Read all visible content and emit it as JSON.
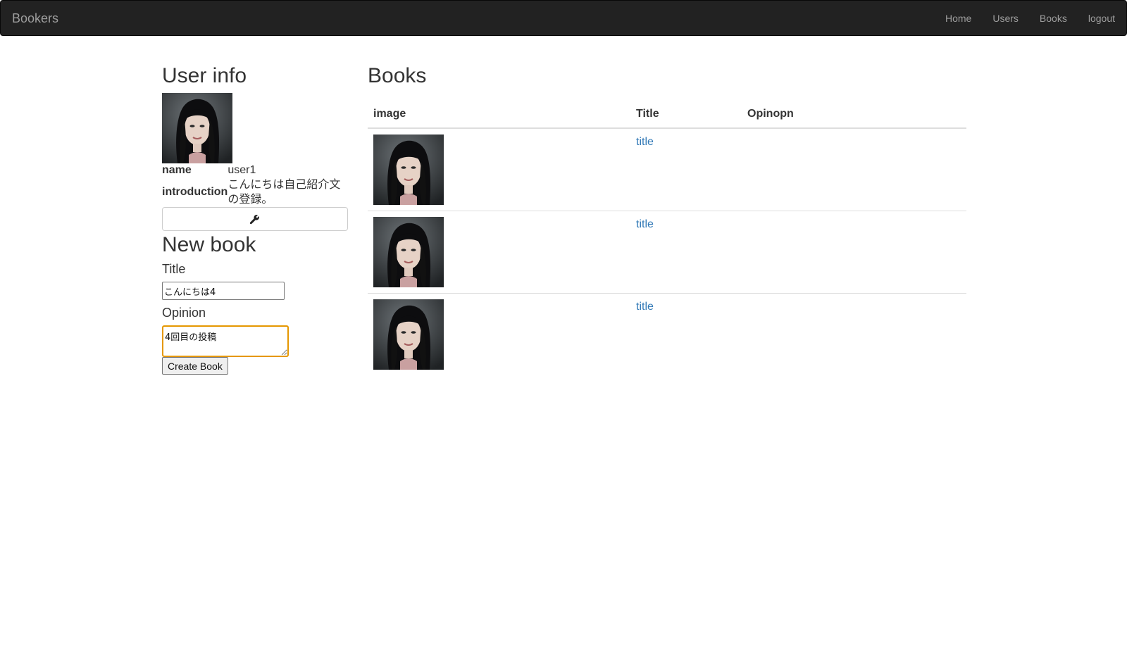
{
  "navbar": {
    "brand": "Bookers",
    "links": [
      "Home",
      "Users",
      "Books",
      "logout"
    ]
  },
  "user_info": {
    "heading": "User info",
    "name_label": "name",
    "name_value": "user1",
    "intro_label": "introduction",
    "intro_value": "こんにちは自己紹介文の登録。",
    "edit_icon": "wrench-icon"
  },
  "new_book": {
    "heading": "New book",
    "title_label": "Title",
    "title_value": "こんにちは4",
    "opinion_label": "Opinion",
    "opinion_value": "4回目の投稿",
    "submit_label": "Create Book"
  },
  "books": {
    "heading": "Books",
    "columns": [
      "image",
      "Title",
      "Opinopn"
    ],
    "rows": [
      {
        "title": "title",
        "opinion": ""
      },
      {
        "title": "title",
        "opinion": ""
      },
      {
        "title": "title",
        "opinion": ""
      }
    ]
  },
  "colors": {
    "navbar_bg": "#222222",
    "link": "#337ab7",
    "focus_border": "#e59700"
  }
}
